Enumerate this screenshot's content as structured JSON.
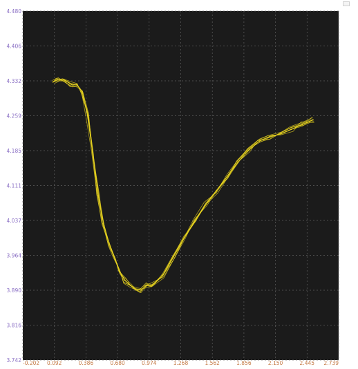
{
  "colors": {
    "frame": "#000000",
    "plot_background": "#1b1b1b",
    "grid": "#5e5e5e",
    "trace": "#e6d21f",
    "y_tick_text": "#8a6fc4",
    "x_tick_text": "#c47a45"
  },
  "chart_data": {
    "type": "line",
    "title": "",
    "xlabel": "",
    "ylabel": "",
    "xlim": [
      -0.202,
      2.739
    ],
    "ylim": [
      3.742,
      4.48
    ],
    "grid": true,
    "legend": "none",
    "x_ticks": [
      "-0.202",
      "0.092",
      "0.386",
      "0.680",
      "0.974",
      "1.268",
      "1.562",
      "1.856",
      "2.150",
      "2.445",
      "2.739"
    ],
    "y_ticks": [
      "4.480",
      "4.406",
      "4.332",
      "4.259",
      "4.185",
      "4.111",
      "4.037",
      "3.964",
      "3.890",
      "3.816",
      "3.742"
    ],
    "series": [
      {
        "x": [
          0.08,
          0.12,
          0.18,
          0.25,
          0.3,
          0.35,
          0.4,
          0.45,
          0.5,
          0.55,
          0.6,
          0.65,
          0.7,
          0.75,
          0.8,
          0.85,
          0.9,
          0.95,
          1.0,
          1.1,
          1.2,
          1.3,
          1.4,
          1.5,
          1.6,
          1.7,
          1.8,
          1.9,
          2.0,
          2.1,
          2.2,
          2.3,
          2.4,
          2.5
        ],
        "y": [
          4.33,
          4.335,
          4.335,
          4.325,
          4.325,
          4.31,
          4.26,
          4.18,
          4.09,
          4.03,
          3.99,
          3.96,
          3.93,
          3.91,
          3.9,
          3.89,
          3.89,
          3.9,
          3.9,
          3.92,
          3.96,
          4.0,
          4.035,
          4.07,
          4.1,
          4.13,
          4.16,
          4.185,
          4.205,
          4.215,
          4.22,
          4.23,
          4.24,
          4.25
        ]
      }
    ]
  }
}
